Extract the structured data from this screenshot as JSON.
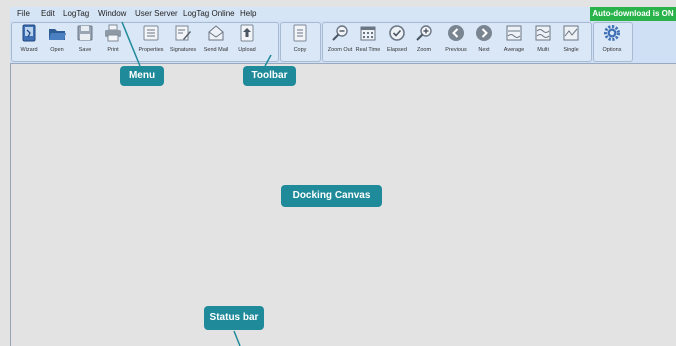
{
  "menu": {
    "items": [
      "File",
      "Edit",
      "LogTag",
      "Window",
      "User Server",
      "LogTag Online",
      "Help"
    ]
  },
  "autodownload": {
    "label": "Auto-download is ON",
    "color": "#29b34a"
  },
  "toolbar": {
    "buttons": [
      {
        "label": "Wizard",
        "icon": "wizard-icon"
      },
      {
        "label": "Open",
        "icon": "open-folder-icon"
      },
      {
        "label": "Save",
        "icon": "save-icon"
      },
      {
        "label": "Print",
        "icon": "print-icon"
      },
      {
        "label": "Properties",
        "icon": "properties-icon"
      },
      {
        "label": "Signatures",
        "icon": "signature-icon"
      },
      {
        "label": "Send Mail",
        "icon": "mail-icon"
      },
      {
        "label": "Upload",
        "icon": "upload-icon"
      },
      {
        "label": "Copy",
        "icon": "copy-icon"
      },
      {
        "label": "Zoom Out",
        "icon": "zoom-out-icon"
      },
      {
        "label": "Real Time",
        "icon": "calendar-icon"
      },
      {
        "label": "Elapsed",
        "icon": "elapsed-icon"
      },
      {
        "label": "Zoom",
        "icon": "zoom-in-icon"
      },
      {
        "label": "Previous",
        "icon": "previous-icon"
      },
      {
        "label": "Next",
        "icon": "next-icon"
      },
      {
        "label": "Average",
        "icon": "average-chart-icon"
      },
      {
        "label": "Multi",
        "icon": "multi-chart-icon"
      },
      {
        "label": "Single",
        "icon": "single-chart-icon"
      },
      {
        "label": "Options",
        "icon": "gear-icon"
      }
    ]
  },
  "callouts": {
    "menu": "Menu",
    "toolbar": "Toolbar",
    "canvas": "Docking Canvas",
    "status": "Status bar"
  },
  "colors": {
    "callout": "#1f8a99",
    "canvas": "#e3e3e3",
    "toolbar": "#cfe0f4",
    "menubar": "#d6e5f6"
  }
}
